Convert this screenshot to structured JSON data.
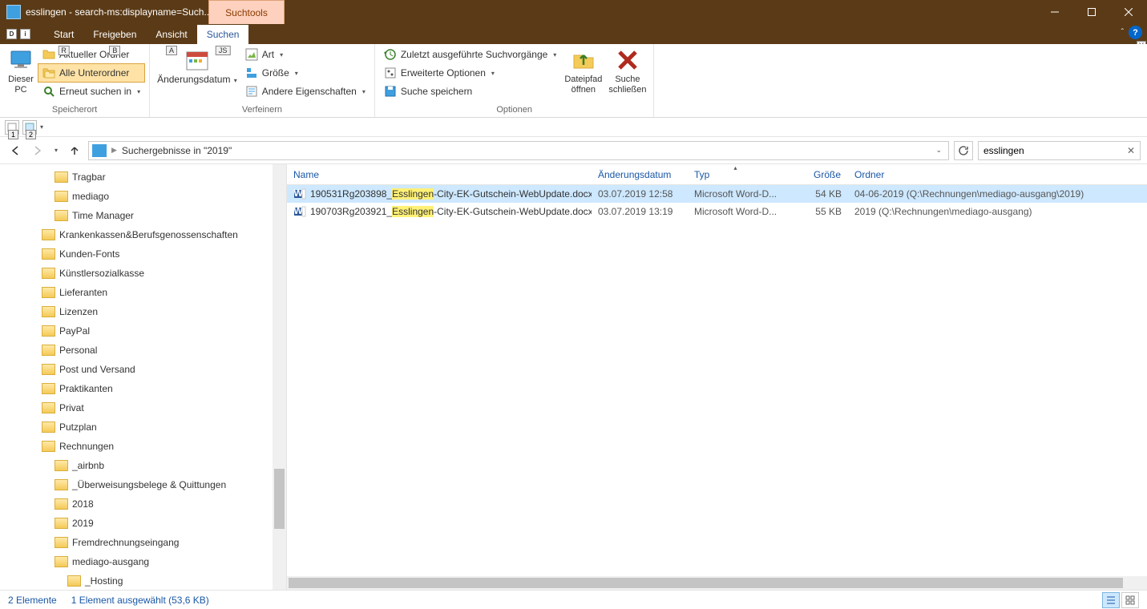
{
  "window": {
    "title": "esslingen - search-ms:displayname=Such...",
    "tools_tab": "Suchtools"
  },
  "tabs": {
    "start": "Start",
    "freigeben": "Freigeben",
    "ansicht": "Ansicht",
    "suchen": "Suchen",
    "key_start": "R",
    "key_freigeben": "B",
    "key_ansicht": "A",
    "key_suchen": "JS"
  },
  "ribbon": {
    "speicherort": {
      "label": "Speicherort",
      "dieser_pc": "Dieser\nPC",
      "aktueller_ordner": "Aktueller Ordner",
      "alle_unterordner": "Alle Unterordner",
      "erneut": "Erneut suchen in"
    },
    "verfeinern": {
      "label": "Verfeinern",
      "aenderungsdatum": "Änderungsdatum",
      "art": "Art",
      "groesse": "Größe",
      "andere": "Andere Eigenschaften"
    },
    "optionen": {
      "label": "Optionen",
      "zuletzt": "Zuletzt ausgeführte Suchvorgänge",
      "erweitert": "Erweiterte Optionen",
      "speichern": "Suche speichern",
      "dateipfad": "Dateipfad\nöffnen",
      "schliessen": "Suche\nschließen"
    }
  },
  "address": {
    "breadcrumb": "Suchergebnisse in \"2019\""
  },
  "search": {
    "value": "esslingen"
  },
  "tree": [
    {
      "indent": 3,
      "label": "Tragbar"
    },
    {
      "indent": 3,
      "label": "mediago"
    },
    {
      "indent": 3,
      "label": "Time Manager"
    },
    {
      "indent": 2,
      "label": "Krankenkassen&Berufsgenossenschaften"
    },
    {
      "indent": 2,
      "label": "Kunden-Fonts"
    },
    {
      "indent": 2,
      "label": "Künstlersozialkasse"
    },
    {
      "indent": 2,
      "label": "Lieferanten"
    },
    {
      "indent": 2,
      "label": "Lizenzen"
    },
    {
      "indent": 2,
      "label": "PayPal"
    },
    {
      "indent": 2,
      "label": "Personal"
    },
    {
      "indent": 2,
      "label": "Post und Versand"
    },
    {
      "indent": 2,
      "label": "Praktikanten"
    },
    {
      "indent": 2,
      "label": "Privat"
    },
    {
      "indent": 2,
      "label": "Putzplan"
    },
    {
      "indent": 2,
      "label": "Rechnungen"
    },
    {
      "indent": 3,
      "label": "_airbnb"
    },
    {
      "indent": 3,
      "label": "_Überweisungsbelege & Quittungen"
    },
    {
      "indent": 3,
      "label": "2018"
    },
    {
      "indent": 3,
      "label": "2019"
    },
    {
      "indent": 3,
      "label": "Fremdrechnungseingang"
    },
    {
      "indent": 3,
      "label": "mediago-ausgang"
    },
    {
      "indent": 4,
      "label": "_Hosting"
    }
  ],
  "columns": {
    "name": "Name",
    "date": "Änderungsdatum",
    "type": "Typ",
    "size": "Größe",
    "folder": "Ordner"
  },
  "rows": [
    {
      "selected": true,
      "pre": "190531Rg203898_",
      "hl": "Esslingen",
      "post": "-City-EK-Gutschein-WebUpdate.docx",
      "date": "03.07.2019 12:58",
      "type": "Microsoft Word-D...",
      "size": "54 KB",
      "folder": "04-06-2019 (Q:\\Rechnungen\\mediago-ausgang\\2019)"
    },
    {
      "selected": false,
      "pre": "190703Rg203921_",
      "hl": "Esslingen",
      "post": "-City-EK-Gutschein-WebUpdate.docx",
      "date": "03.07.2019 13:19",
      "type": "Microsoft Word-D...",
      "size": "55 KB",
      "folder": "2019 (Q:\\Rechnungen\\mediago-ausgang)"
    }
  ],
  "status": {
    "count": "2 Elemente",
    "selected": "1 Element ausgewählt (53,6 KB)"
  }
}
